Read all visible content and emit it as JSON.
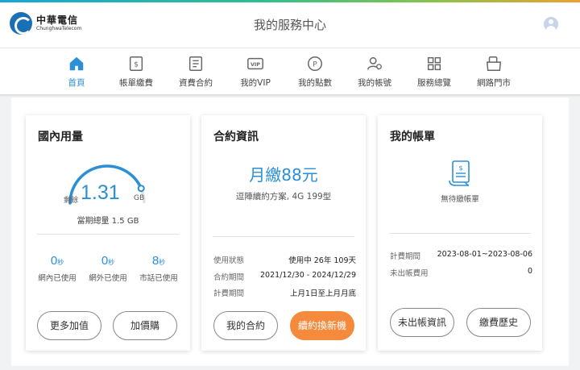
{
  "brand": {
    "name_cn": "中華電信",
    "name_en": "ChunghwaTelecom"
  },
  "header": {
    "title": "我的服務中心"
  },
  "nav": {
    "items": [
      {
        "label": "首頁",
        "icon": "home-icon",
        "active": true
      },
      {
        "label": "帳單繳費",
        "icon": "bill-payment-icon"
      },
      {
        "label": "資費合約",
        "icon": "contract-icon"
      },
      {
        "label": "我的VIP",
        "icon": "vip-icon"
      },
      {
        "label": "我的點數",
        "icon": "points-icon"
      },
      {
        "label": "我的帳號",
        "icon": "account-icon"
      },
      {
        "label": "服務總覽",
        "icon": "grid-icon"
      },
      {
        "label": "網路門市",
        "icon": "shop-icon"
      }
    ]
  },
  "usage": {
    "title": "國內用量",
    "remaining_label": "剩餘",
    "remaining_value": "1.31",
    "remaining_unit": "GB",
    "remaining_fraction": 0.87,
    "total_text": "當期總量 1.5 GB",
    "stats": [
      {
        "value": "0",
        "unit": "秒",
        "label": "網內已使用"
      },
      {
        "value": "0",
        "unit": "秒",
        "label": "網外已使用"
      },
      {
        "value": "8",
        "unit": "秒",
        "label": "市話已使用"
      }
    ],
    "buttons": {
      "more": "更多加值",
      "addon": "加價購"
    }
  },
  "contract": {
    "title": "合約資訊",
    "monthly": "月繳88元",
    "plan": "逗陣續約方案, 4G 199型",
    "rows": [
      {
        "key": "使用狀態",
        "value": "使用中 26年 109天"
      },
      {
        "key": "合約期間",
        "value": "2021/12/30 - 2024/12/29"
      },
      {
        "key": "計費期間",
        "value": "上月1日至上月月底"
      }
    ],
    "buttons": {
      "my_contract": "我的合約",
      "renew": "續約換新機"
    }
  },
  "bill": {
    "title": "我的帳單",
    "no_bill": "無待繳帳單",
    "rows": [
      {
        "key": "計費期間",
        "value": "2023-08-01~2023-08-06"
      },
      {
        "key": "未出帳費用",
        "value": "0"
      }
    ],
    "buttons": {
      "unbilled": "未出帳資訊",
      "history": "繳費歷史"
    }
  },
  "colors": {
    "accent": "#2b8fd6",
    "orange": "#f58a3d",
    "brand": "#1a6fb5"
  }
}
